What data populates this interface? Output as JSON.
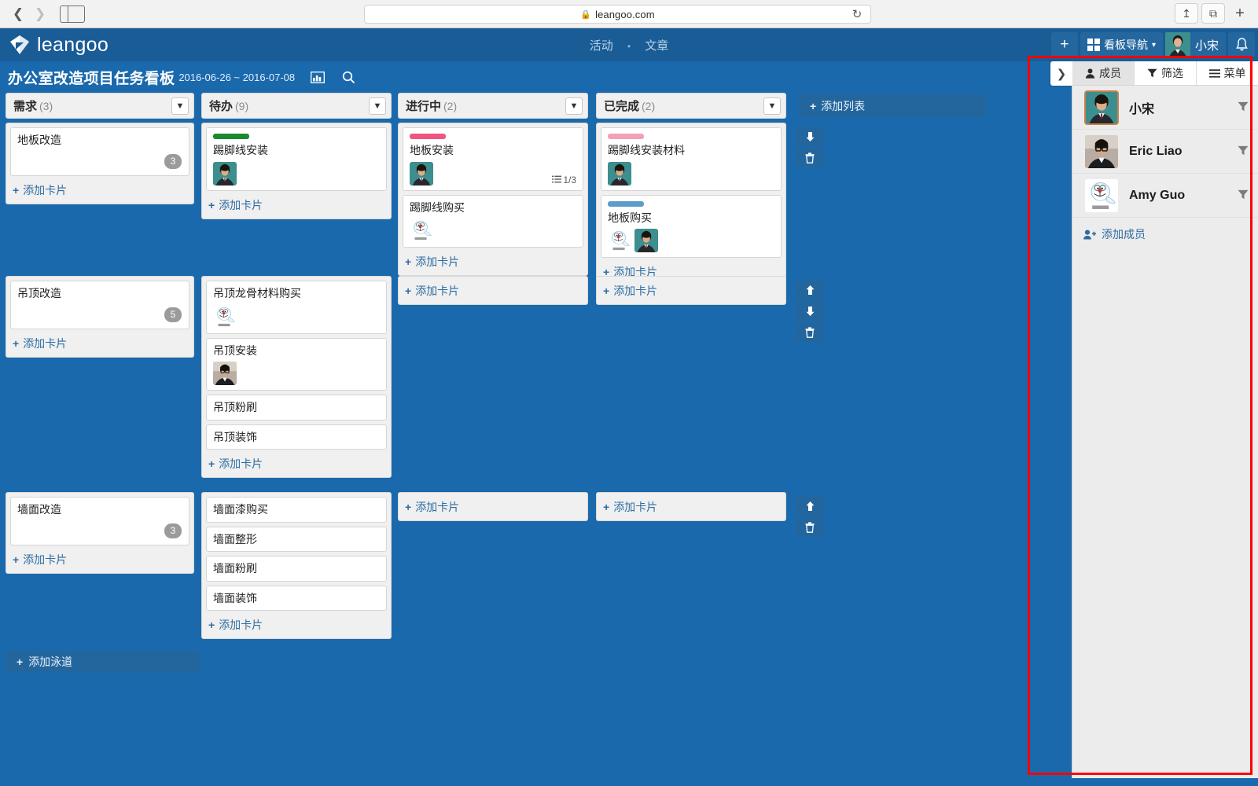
{
  "browser": {
    "back_icon": "chevron-left-icon",
    "forward_icon": "chevron-right-icon",
    "sidebar_icon": "sidebar-toggle-icon",
    "url": "leangoo.com",
    "lock_icon": "lock-icon",
    "reload_icon": "reload-icon",
    "share_icon": "share-icon",
    "tabs_icon": "tabs-icon",
    "newtab_label": "+"
  },
  "topnav": {
    "brand": "leangoo",
    "center_links": [
      "活动",
      "文章"
    ],
    "dot": "•",
    "add_label": "+",
    "grid_icon": "grid-icon",
    "board_nav_label": "看板导航",
    "caret": "▾",
    "user_name": "小宋",
    "bell_icon": "bell-icon"
  },
  "board_header": {
    "title": "办公室改造项目任务看板",
    "dates": "2016-06-26 ~ 2016-07-08",
    "chart_icon": "chart-icon",
    "search_icon": "search-icon"
  },
  "board": {
    "add_list_label": "添加列表",
    "add_card_label": "添加卡片",
    "add_lane_label": "添加泳道",
    "columns": [
      {
        "title": "需求",
        "count": "(3)"
      },
      {
        "title": "待办",
        "count": "(9)"
      },
      {
        "title": "进行中",
        "count": "(2)"
      },
      {
        "title": "已完成",
        "count": "(2)"
      }
    ],
    "lanes": [
      {
        "name": "地板改造",
        "count": "3",
        "actions": [
          "arrow-down-icon",
          "trash-icon"
        ],
        "cells": [
          [
            {
              "title": "踢脚线安装",
              "label_color": "#1a8a2e",
              "avatars": [
                "xiaosong"
              ]
            }
          ],
          [
            {
              "title": "地板安装",
              "label_color": "#f0557f",
              "avatars": [
                "xiaosong"
              ],
              "checklist": "1/3"
            },
            {
              "title": "踢脚线购买",
              "avatars": [
                "amy"
              ]
            }
          ],
          [
            {
              "title": "踢脚线安装材料",
              "label_color": "#f4a0b8",
              "avatars": [
                "xiaosong"
              ]
            },
            {
              "title": "地板购买",
              "label_color": "#5c9cc8",
              "avatars": [
                "amy",
                "xiaosong"
              ]
            }
          ]
        ]
      },
      {
        "name": "吊顶改造",
        "count": "5",
        "actions": [
          "arrow-up-icon",
          "arrow-down-icon",
          "trash-icon"
        ],
        "cells": [
          [
            {
              "title": "吊顶龙骨材料购买",
              "avatars": [
                "amy"
              ]
            },
            {
              "title": "吊顶安装",
              "avatars": [
                "eric"
              ]
            },
            {
              "title": "吊顶粉刷",
              "avatars": []
            },
            {
              "title": "吊顶装饰",
              "avatars": []
            }
          ],
          [],
          []
        ]
      },
      {
        "name": "墙面改造",
        "count": "3",
        "actions": [
          "arrow-up-icon",
          "trash-icon"
        ],
        "cells": [
          [
            {
              "title": "墙面漆购买",
              "avatars": []
            },
            {
              "title": "墙面整形",
              "avatars": []
            },
            {
              "title": "墙面粉刷",
              "avatars": []
            },
            {
              "title": "墙面装饰",
              "avatars": []
            }
          ],
          [],
          []
        ]
      }
    ]
  },
  "right_panel": {
    "collapse_icon": "chevron-right-icon",
    "tabs": [
      {
        "label": "成员",
        "icon": "person-icon",
        "active": true
      },
      {
        "label": "筛选",
        "icon": "filter-icon",
        "active": false
      },
      {
        "label": "菜单",
        "icon": "hamburger-icon",
        "active": false
      }
    ],
    "members": [
      {
        "name": "小宋",
        "avatar": "xiaosong",
        "selected": true,
        "filter_icon": "filter-icon"
      },
      {
        "name": "Eric Liao",
        "avatar": "eric",
        "selected": false,
        "filter_icon": "filter-icon"
      },
      {
        "name": "Amy Guo",
        "avatar": "amy",
        "selected": false,
        "filter_icon": "filter-icon"
      }
    ],
    "add_member_label": "添加成员",
    "add_member_icon": "add-person-icon"
  },
  "annotation": {
    "color": "#ff0000"
  }
}
